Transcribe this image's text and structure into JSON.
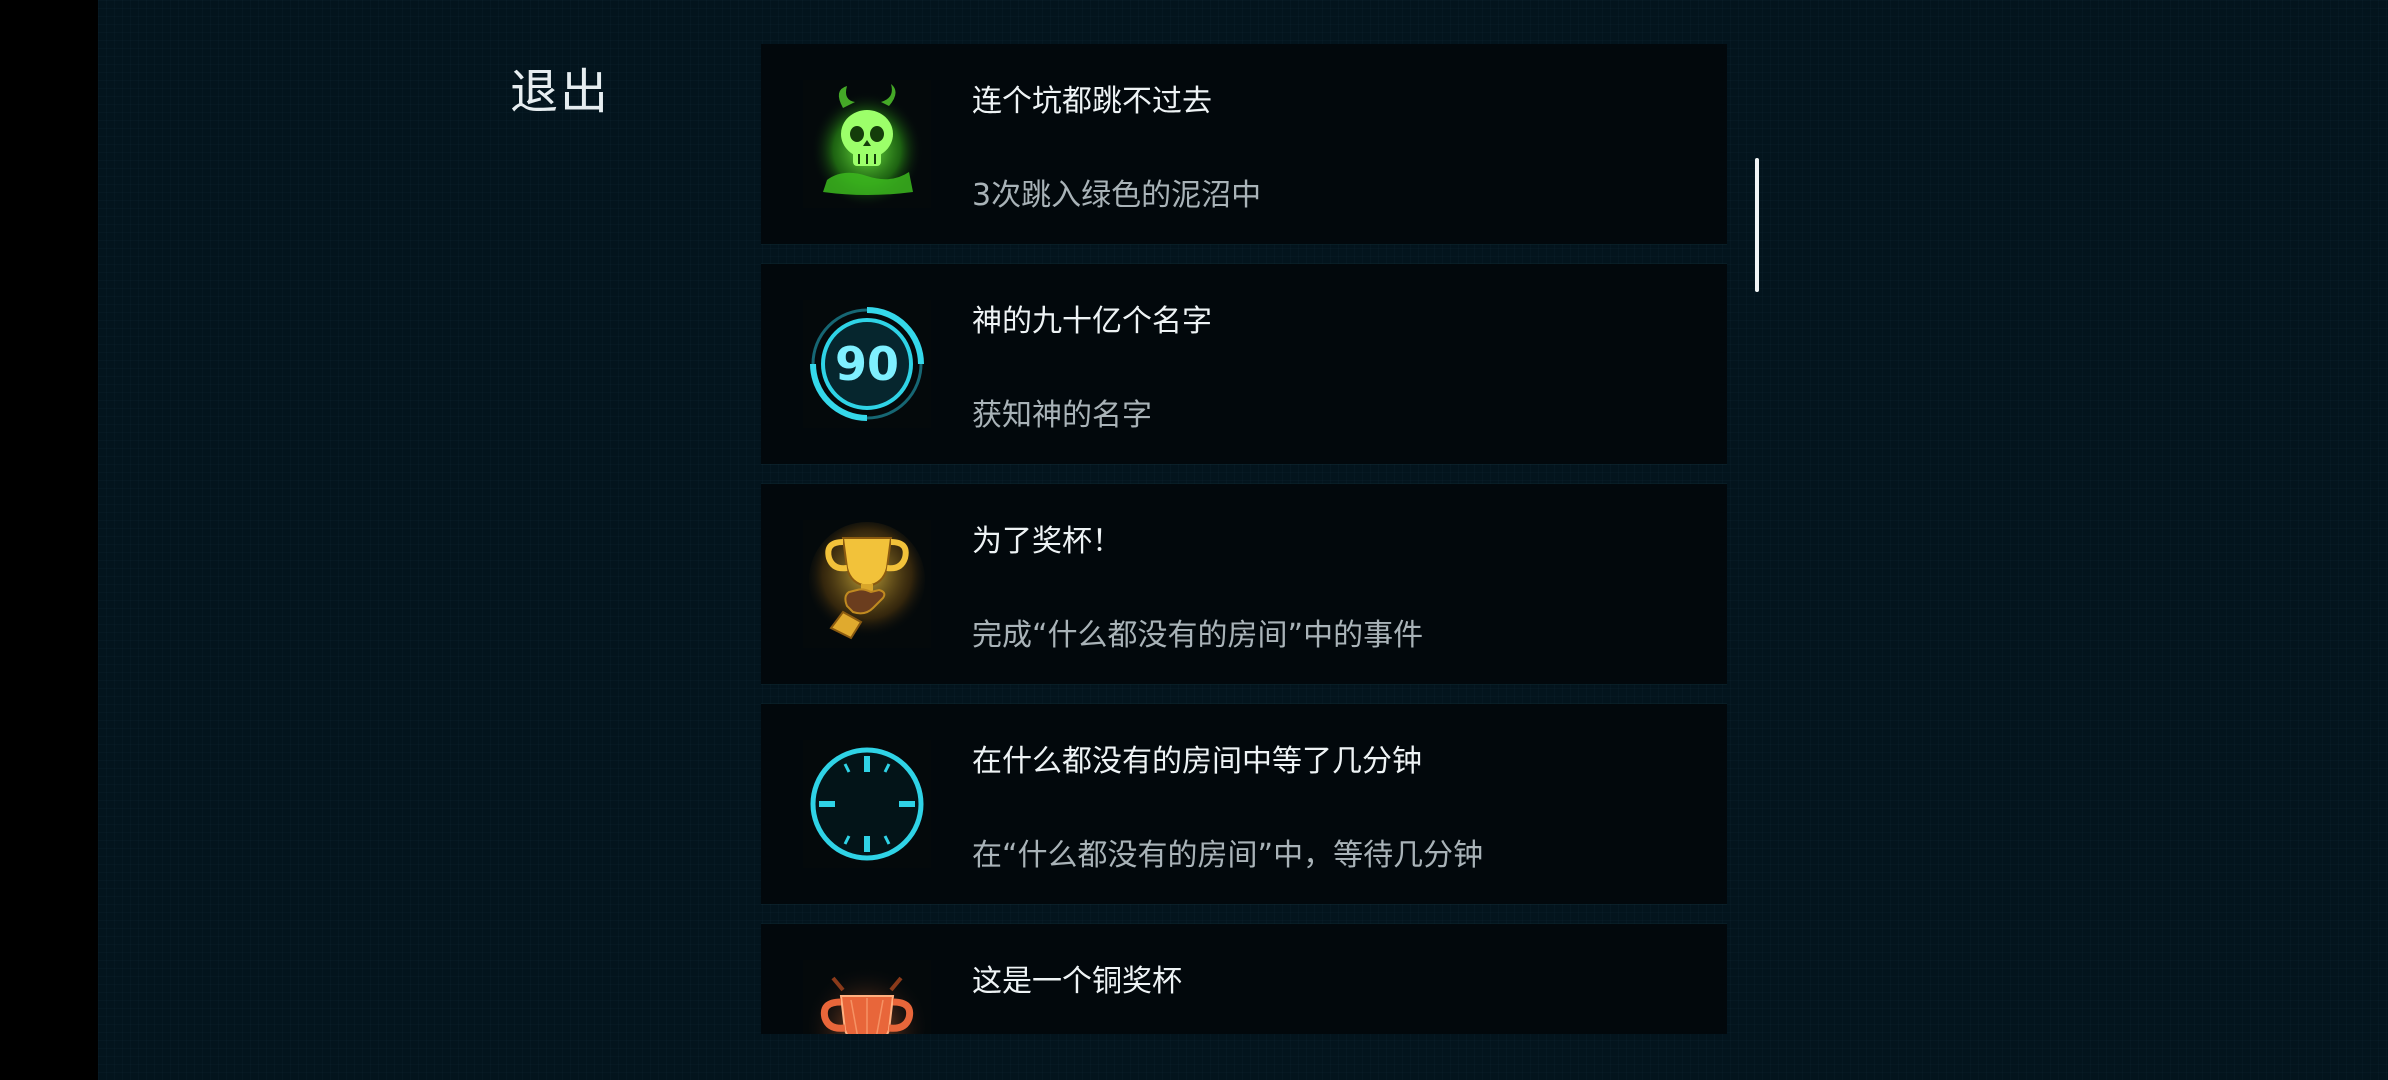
{
  "exit_label": "退出",
  "achievements": [
    {
      "title": "连个坑都跳不过去",
      "desc": "3次跳入绿色的泥沼中",
      "icon": "green-skull-icon"
    },
    {
      "title": "神的九十亿个名字",
      "desc": "获知神的名字",
      "icon": "ninety-badge-icon",
      "icon_text": "90"
    },
    {
      "title": "为了奖杯！",
      "desc": "完成“什么都没有的房间”中的事件",
      "icon": "golden-trophy-hand-icon"
    },
    {
      "title": "在什么都没有的房间中等了几分钟",
      "desc": "在“什么都没有的房间”中，等待几分钟",
      "icon": "clock-icon"
    },
    {
      "title": "这是一个铜奖杯",
      "desc": "",
      "icon": "bronze-trophy-icon"
    }
  ],
  "colors": {
    "background": "#03141d",
    "card": "#02080c",
    "title_text": "#eef3f5",
    "desc_text": "#a9b3b8",
    "skull_green": "#5fe03a",
    "cyan": "#2fd3e6",
    "gold": "#e8b830",
    "bronze": "#e8663a"
  }
}
